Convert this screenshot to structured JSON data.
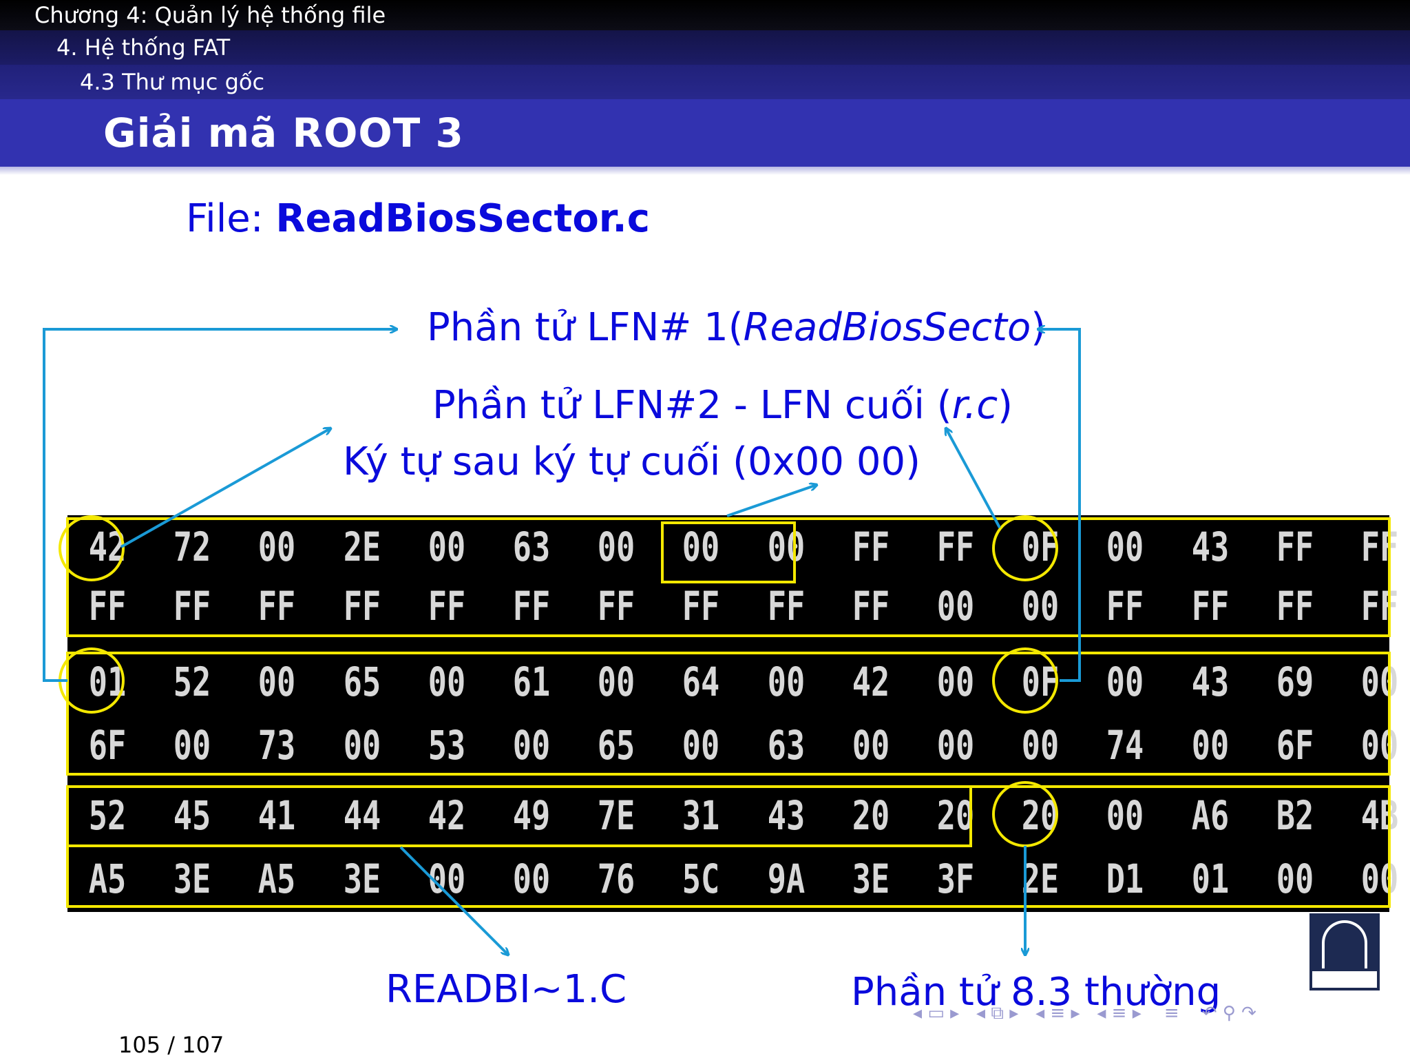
{
  "header": {
    "chapter": "Chương 4: Quản lý hệ thống file",
    "section": "4. Hệ thống FAT",
    "subsection": "4.3 Thư mục gốc",
    "slide_title": "Giải mã ROOT 3"
  },
  "file_line": {
    "prefix": "File: ",
    "filename": "ReadBiosSector.c"
  },
  "annotations": {
    "lfn1_prefix": "Phần tử LFN# 1(",
    "lfn1_italic": "ReadBiosSecto",
    "lfn1_suffix": ")",
    "lfn2_prefix": "Phần tử LFN#2 - LFN cuối (",
    "lfn2_italic": "r.c",
    "lfn2_suffix": ")",
    "after_last_char": "Ký tự sau ký tự cuối (0x00 00)",
    "short_name": "READBI∼1.C",
    "normal_83": "Phần tử 8.3 thường"
  },
  "hex_rows": [
    [
      "42",
      "72",
      "00",
      "2E",
      "00",
      "63",
      "00",
      "00",
      "00",
      "FF",
      "FF",
      "0F",
      "00",
      "43",
      "FF",
      "FF"
    ],
    [
      "FF",
      "FF",
      "FF",
      "FF",
      "FF",
      "FF",
      "FF",
      "FF",
      "FF",
      "FF",
      "00",
      "00",
      "FF",
      "FF",
      "FF",
      "FF"
    ],
    [
      "01",
      "52",
      "00",
      "65",
      "00",
      "61",
      "00",
      "64",
      "00",
      "42",
      "00",
      "0F",
      "00",
      "43",
      "69",
      "00"
    ],
    [
      "6F",
      "00",
      "73",
      "00",
      "53",
      "00",
      "65",
      "00",
      "63",
      "00",
      "00",
      "00",
      "74",
      "00",
      "6F",
      "00"
    ],
    [
      "52",
      "45",
      "41",
      "44",
      "42",
      "49",
      "7E",
      "31",
      "43",
      "20",
      "20",
      "20",
      "00",
      "A6",
      "B2",
      "4B"
    ],
    [
      "A5",
      "3E",
      "A5",
      "3E",
      "00",
      "00",
      "76",
      "5C",
      "9A",
      "3E",
      "3F",
      "2E",
      "D1",
      "01",
      "00",
      "00"
    ]
  ],
  "footer": {
    "page_current": "105",
    "page_sep": " / ",
    "page_total": "107"
  },
  "colors": {
    "header_dark": "#000000",
    "title_bar": "#3232b0",
    "text_blue": "#0a0adc",
    "arrow": "#1a9ad6",
    "highlight": "#f4e800"
  },
  "icons": [
    "left-arrow-icon",
    "frame-icon",
    "right-arrow-icon",
    "subsection-icon",
    "section-icon",
    "align-icon",
    "undo-icon",
    "search-icon"
  ]
}
